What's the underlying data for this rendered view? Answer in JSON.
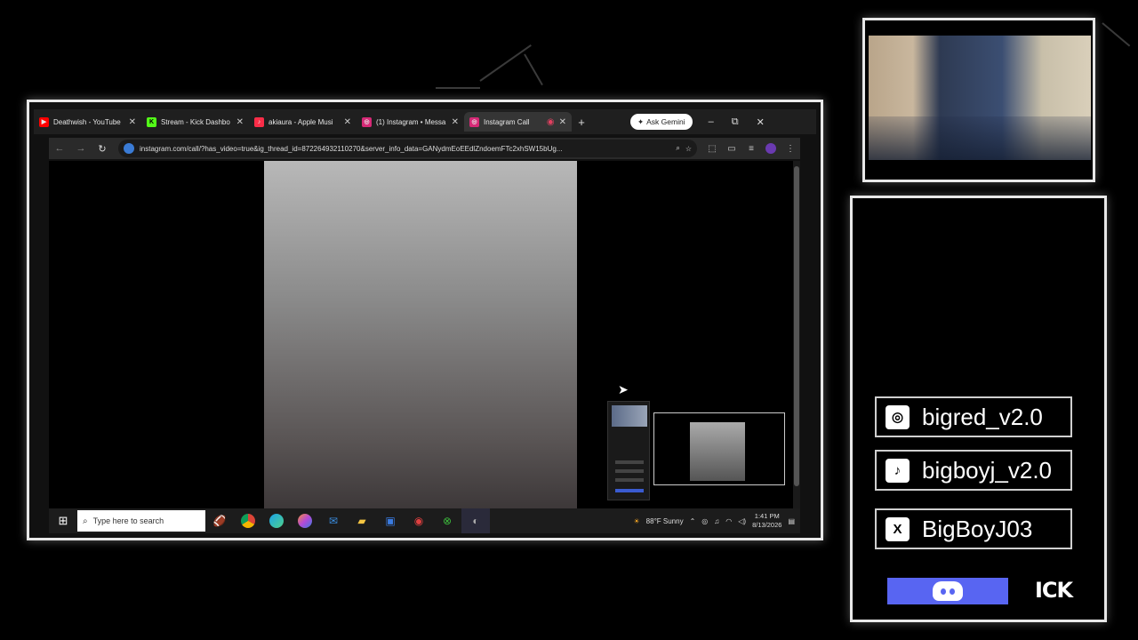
{
  "browser": {
    "tabs": [
      {
        "label": "Deathwish - YouTube",
        "favicon": "youtube-icon",
        "color": "#ff0000"
      },
      {
        "label": "Stream - Kick Dashbo",
        "favicon": "kick-icon",
        "color": "#53fc18"
      },
      {
        "label": "akiaura - Apple Musi",
        "favicon": "apple-music-icon",
        "color": "#fa2d48"
      },
      {
        "label": "(1) Instagram • Messa",
        "favicon": "instagram-icon",
        "color": "#d62976"
      },
      {
        "label": "Instagram Call",
        "favicon": "instagram-icon",
        "color": "#d62976",
        "active": true
      }
    ],
    "new_tab": "+",
    "gemini_label": "Ask Gemini",
    "url": "instagram.com/call/?has_video=true&ig_thread_id=872264932110270&server_info_data=GANydmEoEEdlZndoemFTc2xhSW15bUg...",
    "window_controls": {
      "minimize": "–",
      "restore": "⧉",
      "close": "✕"
    }
  },
  "taskbar": {
    "search_placeholder": "Type here to search",
    "weather": "88°F  Sunny",
    "time": "1:41 PM",
    "date": "8/13/2026"
  },
  "socials": {
    "instagram": "bigred_v2.0",
    "tiktok": "bigboyj_v2.0",
    "x": "BigBoyJ03",
    "kick": "ICK"
  },
  "colors": {
    "discord": "#5865f2",
    "frame_border": "#e8e8e8"
  }
}
